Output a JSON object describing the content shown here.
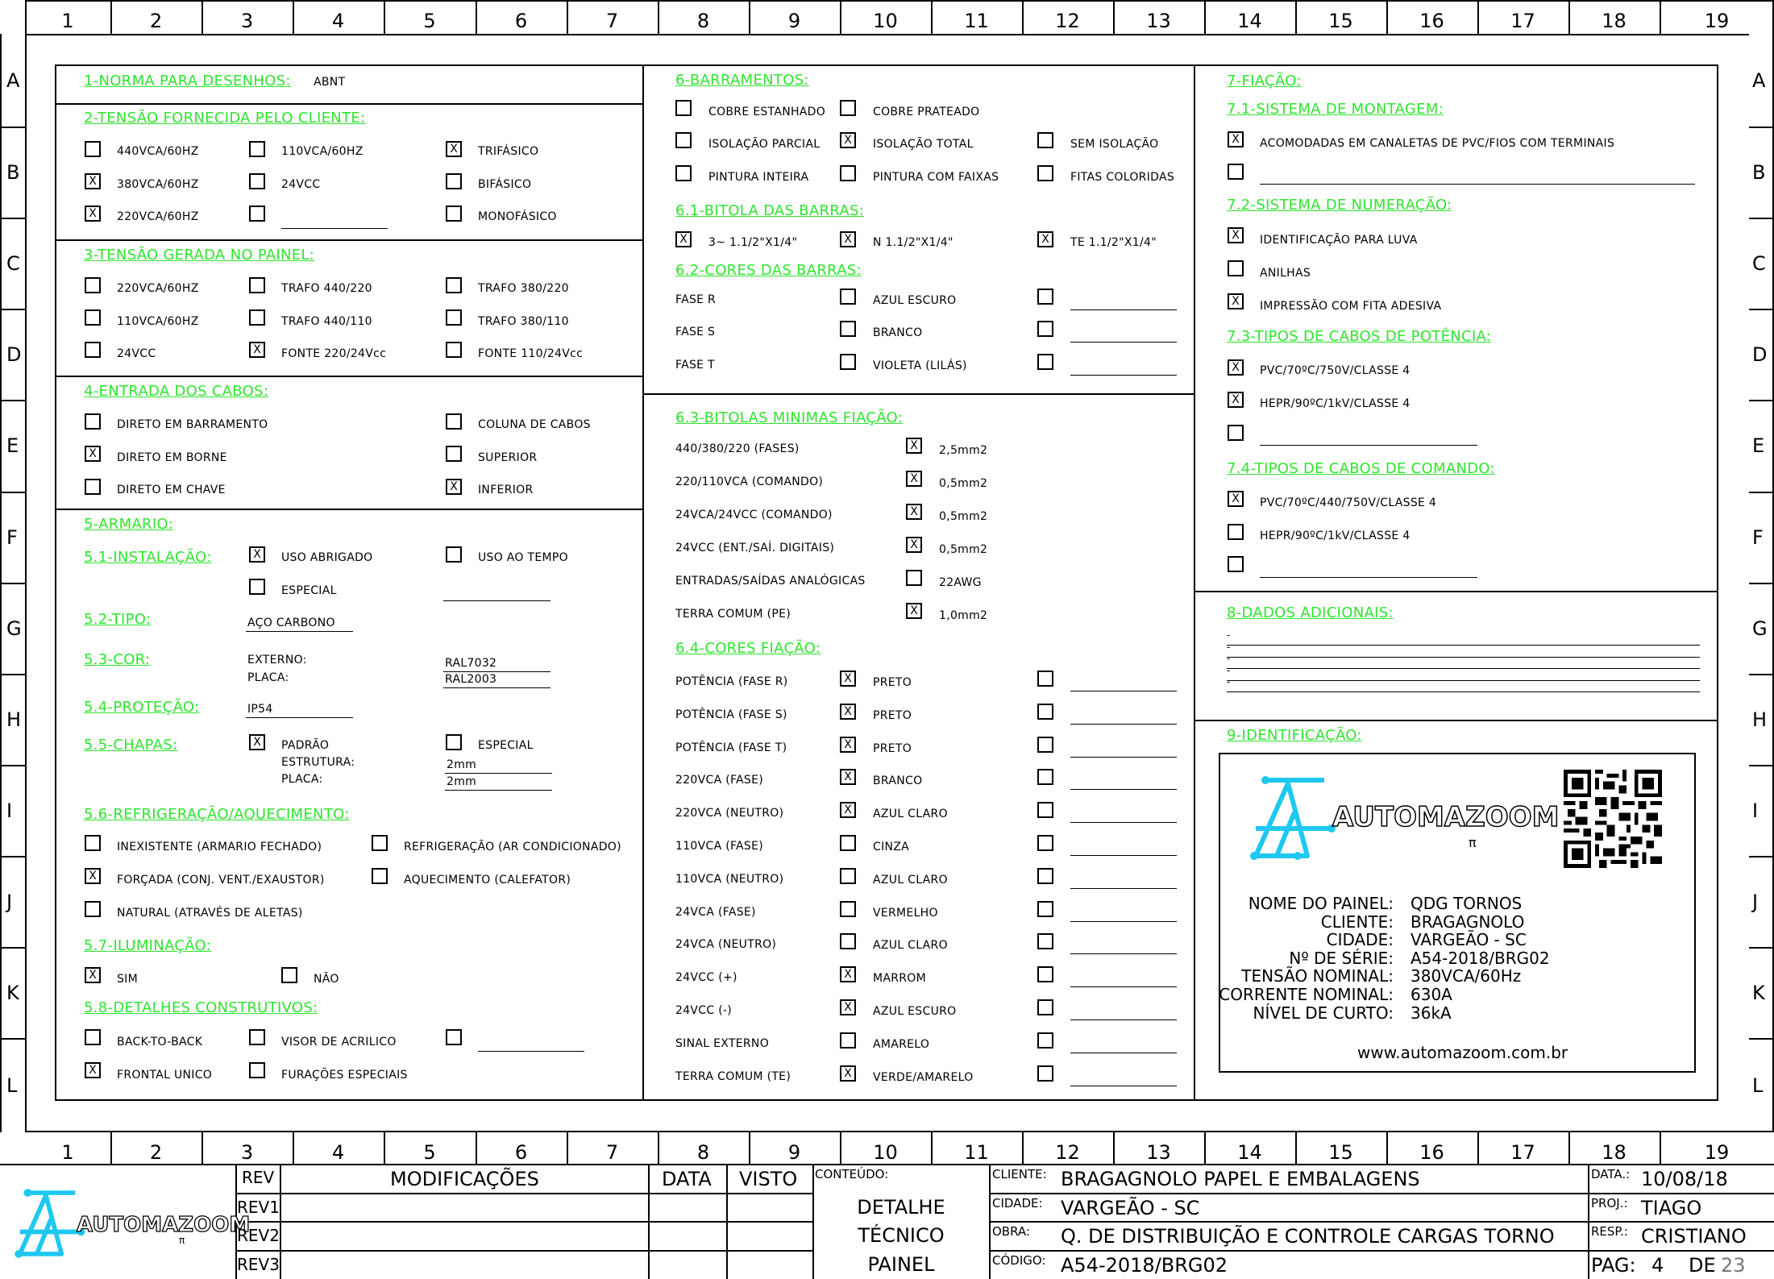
{
  "grid": {
    "columns": [
      "1",
      "2",
      "3",
      "4",
      "5",
      "6",
      "7",
      "8",
      "9",
      "10",
      "11",
      "12",
      "13",
      "14",
      "15",
      "16",
      "17",
      "18",
      "19"
    ],
    "rows": [
      "A",
      "B",
      "C",
      "D",
      "E",
      "F",
      "G",
      "H",
      "I",
      "J",
      "K",
      "L"
    ]
  },
  "s1": {
    "title": "1-NORMA PARA DESENHOS:",
    "value": "ABNT"
  },
  "s2": {
    "title": "2-TENSÃO FORNECIDA PELO CLIENTE:",
    "items": [
      {
        "label": "440VCA/60HZ",
        "checked": false
      },
      {
        "label": "110VCA/60HZ",
        "checked": false
      },
      {
        "label": "TRIFÁSICO",
        "checked": true
      },
      {
        "label": "380VCA/60HZ",
        "checked": true
      },
      {
        "label": "24VCC",
        "checked": false
      },
      {
        "label": "BIFÁSICO",
        "checked": false
      },
      {
        "label": "220VCA/60HZ",
        "checked": true
      },
      {
        "label": "",
        "checked": false
      },
      {
        "label": "MONOFÁSICO",
        "checked": false
      }
    ]
  },
  "s3": {
    "title": "3-TENSÃO GERADA NO PAINEL:",
    "items": [
      {
        "label": "220VCA/60HZ",
        "checked": false
      },
      {
        "label": "TRAFO 440/220",
        "checked": false
      },
      {
        "label": "TRAFO 380/220",
        "checked": false
      },
      {
        "label": "110VCA/60HZ",
        "checked": false
      },
      {
        "label": "TRAFO 440/110",
        "checked": false
      },
      {
        "label": "TRAFO 380/110",
        "checked": false
      },
      {
        "label": "24VCC",
        "checked": false
      },
      {
        "label": "FONTE 220/24Vcc",
        "checked": true
      },
      {
        "label": "FONTE 110/24Vcc",
        "checked": false
      }
    ]
  },
  "s4": {
    "title": "4-ENTRADA DOS CABOS:",
    "items": [
      {
        "label": "DIRETO EM BARRAMENTO",
        "checked": false
      },
      {
        "label": "COLUNA DE CABOS",
        "checked": false
      },
      {
        "label": "DIRETO EM BORNE",
        "checked": true
      },
      {
        "label": "SUPERIOR",
        "checked": false
      },
      {
        "label": "DIRETO EM CHAVE",
        "checked": false
      },
      {
        "label": "INFERIOR",
        "checked": true
      }
    ]
  },
  "s5": {
    "title": "5-ARMARIO:",
    "s51": {
      "title": "5.1-INSTALAÇÃO:",
      "items": [
        {
          "label": "USO ABRIGADO",
          "checked": true
        },
        {
          "label": "USO AO TEMPO",
          "checked": false
        },
        {
          "label": "ESPECIAL",
          "checked": false
        }
      ]
    },
    "s52": {
      "title": "5.2-TIPO:",
      "value": "AÇO CARBONO"
    },
    "s53": {
      "title": "5.3-COR:",
      "externo_label": "EXTERNO:",
      "placa_label": "PLACA:",
      "externo": "RAL7032",
      "placa": "RAL2003"
    },
    "s54": {
      "title": "5.4-PROTEÇÃO:",
      "value": "IP54"
    },
    "s55": {
      "title": "5.5-CHAPAS:",
      "items": [
        {
          "label": "PADRÃO",
          "checked": true
        },
        {
          "label": "ESPECIAL",
          "checked": false
        }
      ],
      "estrutura_label": "ESTRUTURA:",
      "placa_label": "PLACA:",
      "estrutura": "2mm",
      "placa": "2mm"
    },
    "s56": {
      "title": "5.6-REFRIGERAÇÃO/AQUECIMENTO:",
      "items": [
        {
          "label": "INEXISTENTE (ARMARIO FECHADO)",
          "checked": false
        },
        {
          "label": "REFRIGERAÇÃO (AR CONDICIONADO)",
          "checked": false
        },
        {
          "label": "FORÇADA (CONJ. VENT./EXAUSTOR)",
          "checked": true
        },
        {
          "label": "AQUECIMENTO (CALEFATOR)",
          "checked": false
        },
        {
          "label": "NATURAL (ATRAVÉS DE ALETAS)",
          "checked": false
        }
      ]
    },
    "s57": {
      "title": "5.7-ILUMINAÇÃO:",
      "items": [
        {
          "label": "SIM",
          "checked": true
        },
        {
          "label": "NÃO",
          "checked": false
        }
      ]
    },
    "s58": {
      "title": "5.8-DETALHES CONSTRUTIVOS:",
      "items": [
        {
          "label": "BACK-TO-BACK",
          "checked": false
        },
        {
          "label": "VISOR DE ACRILICO",
          "checked": false
        },
        {
          "label": "",
          "checked": false
        },
        {
          "label": "FRONTAL UNICO",
          "checked": true
        },
        {
          "label": "FURAÇÕES ESPECIAIS",
          "checked": false
        }
      ]
    }
  },
  "s6": {
    "title": "6-BARRAMENTOS:",
    "items": [
      {
        "label": "COBRE ESTANHADO",
        "checked": false
      },
      {
        "label": "COBRE PRATEADO",
        "checked": false
      },
      {
        "label": "ISOLAÇÃO PARCIAL",
        "checked": false
      },
      {
        "label": "ISOLAÇÃO TOTAL",
        "checked": true
      },
      {
        "label": "SEM ISOLAÇÃO",
        "checked": false
      },
      {
        "label": "PINTURA INTEIRA",
        "checked": false
      },
      {
        "label": "PINTURA COM FAIXAS",
        "checked": false
      },
      {
        "label": "FITAS COLORIDAS",
        "checked": false
      }
    ],
    "s61": {
      "title": "6.1-BITOLA DAS BARRAS:",
      "items": [
        {
          "label": "3~  1.1/2\"X1/4\"",
          "checked": true
        },
        {
          "label": "N    1.1/2\"X1/4\"",
          "checked": true
        },
        {
          "label": "TE  1.1/2\"X1/4\"",
          "checked": true
        }
      ]
    },
    "s62": {
      "title": "6.2-CORES DAS BARRAS:",
      "rows": [
        {
          "label": "FASE R",
          "color": "AZUL ESCURO",
          "checked": false
        },
        {
          "label": "FASE S",
          "color": "BRANCO",
          "checked": false
        },
        {
          "label": "FASE T",
          "color": "VIOLETA (LILÁS)",
          "checked": false
        }
      ]
    },
    "s63": {
      "title": "6.3-BITOLAS MINIMAS FIAÇÃO:",
      "rows": [
        {
          "label": "440/380/220 (FASES)",
          "value": "2,5mm2",
          "checked": true
        },
        {
          "label": "220/110VCA (COMANDO)",
          "value": "0,5mm2",
          "checked": true
        },
        {
          "label": "24VCA/24VCC (COMANDO)",
          "value": "0,5mm2",
          "checked": true
        },
        {
          "label": "24VCC (ENT./SAÍ. DIGITAIS)",
          "value": "0,5mm2",
          "checked": true
        },
        {
          "label": "ENTRADAS/SAÍDAS ANALÓGICAS",
          "value": "22AWG",
          "checked": false
        },
        {
          "label": "TERRA COMUM (PE)",
          "value": "1,0mm2",
          "checked": true
        }
      ]
    },
    "s64": {
      "title": "6.4-CORES FIAÇÃO:",
      "rows": [
        {
          "label": "POTÊNCIA (FASE R)",
          "color": "PRETO",
          "checked": true
        },
        {
          "label": "POTÊNCIA (FASE S)",
          "color": "PRETO",
          "checked": true
        },
        {
          "label": "POTÊNCIA (FASE T)",
          "color": "PRETO",
          "checked": true
        },
        {
          "label": "220VCA (FASE)",
          "color": "BRANCO",
          "checked": true
        },
        {
          "label": "220VCA (NEUTRO)",
          "color": "AZUL CLARO",
          "checked": true
        },
        {
          "label": "110VCA (FASE)",
          "color": "CINZA",
          "checked": false
        },
        {
          "label": "110VCA (NEUTRO)",
          "color": "AZUL CLARO",
          "checked": false
        },
        {
          "label": "24VCA (FASE)",
          "color": "VERMELHO",
          "checked": false
        },
        {
          "label": "24VCA (NEUTRO)",
          "color": "AZUL CLARO",
          "checked": false
        },
        {
          "label": "24VCC (+)",
          "color": "MARROM",
          "checked": true
        },
        {
          "label": "24VCC (-)",
          "color": "AZUL ESCURO",
          "checked": true
        },
        {
          "label": "SINAL EXTERNO",
          "color": "AMARELO",
          "checked": false
        },
        {
          "label": "TERRA COMUM (TE)",
          "color": "VERDE/AMARELO",
          "checked": true
        }
      ]
    }
  },
  "s7": {
    "title": "7-FIAÇÃO:",
    "s71": {
      "title": "7.1-SISTEMA DE MONTAGEM:",
      "items": [
        {
          "label": "ACOMODADAS EM CANALETAS DE PVC/FIOS COM TERMINAIS",
          "checked": true
        },
        {
          "label": "",
          "checked": false
        }
      ]
    },
    "s72": {
      "title": "7.2-SISTEMA DE NUMERAÇÃO:",
      "items": [
        {
          "label": "IDENTIFICAÇÃO PARA LUVA",
          "checked": true
        },
        {
          "label": "ANILHAS",
          "checked": false
        },
        {
          "label": "IMPRESSÃO COM FITA ADESIVA",
          "checked": true
        }
      ]
    },
    "s73": {
      "title": "7.3-TIPOS DE CABOS DE POTÊNCIA:",
      "items": [
        {
          "label": "PVC/70ºC/750V/CLASSE 4",
          "checked": true
        },
        {
          "label": "HEPR/90ºC/1kV/CLASSE 4",
          "checked": true
        },
        {
          "label": "",
          "checked": false
        }
      ]
    },
    "s74": {
      "title": "7.4-TIPOS DE CABOS DE COMANDO:",
      "items": [
        {
          "label": "PVC/70ºC/440/750V/CLASSE 4",
          "checked": true
        },
        {
          "label": "HEPR/90ºC/1kV/CLASSE 4",
          "checked": false
        },
        {
          "label": "",
          "checked": false
        }
      ]
    }
  },
  "s8": {
    "title": "8-DADOS ADICIONAIS:",
    "lines": [
      "-",
      "-",
      "-",
      "-",
      "-"
    ]
  },
  "s9": {
    "title": "9-IDENTIFICAÇÃO:",
    "logo": "AUTOMAZOOM",
    "logo_sub": "π",
    "fields": [
      {
        "label": "NOME DO PAINEL:",
        "value": "QDG TORNOS"
      },
      {
        "label": "CLIENTE:",
        "value": "BRAGAGNOLO"
      },
      {
        "label": "CIDADE:",
        "value": "VARGEÃO - SC"
      },
      {
        "label": "Nº DE SÉRIE:",
        "value": "A54-2018/BRG02"
      },
      {
        "label": "TENSÃO NOMINAL:",
        "value": "380VCA/60Hz"
      },
      {
        "label": "CORRENTE NOMINAL:",
        "value": "630A"
      },
      {
        "label": "NÍVEL DE CURTO:",
        "value": "36kA"
      }
    ],
    "website": "www.automazoom.com.br"
  },
  "titleblock": {
    "logo": "AUTOMAZOOM",
    "logo_sub": "π",
    "rev_header": "REV",
    "modificacoes": "MODIFICAÇÕES",
    "data": "DATA",
    "visto": "VISTO",
    "revs": [
      "REV1",
      "REV2",
      "REV3"
    ],
    "conteudo_label": "CONTEÚDO:",
    "conteudo": [
      "DETALHE",
      "TÉCNICO",
      "PAINEL"
    ],
    "cliente_label": "CLIENTE:",
    "cliente": "BRAGAGNOLO PAPEL E EMBALAGENS",
    "cidade_label": "CIDADE:",
    "cidade": "VARGEÃO - SC",
    "obra_label": "OBRA:",
    "obra": "Q. DE DISTRIBUIÇÃO E CONTROLE CARGAS TORNO",
    "codigo_label": "CÓDIGO:",
    "codigo": "A54-2018/BRG02",
    "data_label": "DATA.:",
    "data_value": "10/08/18",
    "proj_label": "PROJ.:",
    "proj": "TIAGO",
    "resp_label": "RESP.:",
    "resp": "CRISTIANO",
    "pag_label": "PAG:",
    "pag": "4",
    "de_label": "DE",
    "total": "23"
  },
  "colors": {
    "section": "#2ee52e",
    "logo": "#1ec8f0"
  }
}
